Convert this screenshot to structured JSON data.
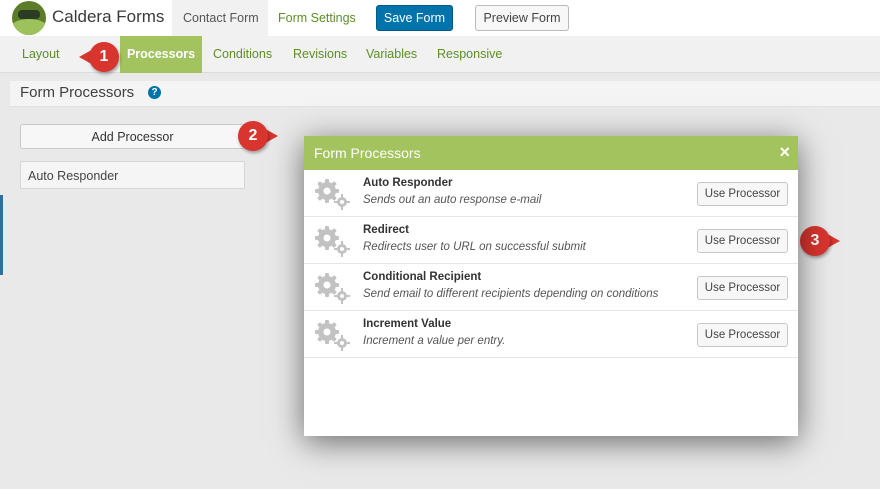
{
  "header": {
    "brand": "Caldera Forms",
    "tabs": [
      "Contact Form",
      "Form Settings"
    ],
    "save_label": "Save Form",
    "preview_label": "Preview Form"
  },
  "subnav": {
    "items": [
      "Layout",
      "Processors",
      "Conditions",
      "Revisions",
      "Variables",
      "Responsive"
    ]
  },
  "panel": {
    "title": "Form Processors",
    "help": "?",
    "add_label": "Add Processor",
    "processors": [
      "Auto Responder"
    ]
  },
  "callouts": [
    "1",
    "2",
    "3"
  ],
  "modal": {
    "title": "Form Processors",
    "close": "×",
    "button_label": "Use Processor",
    "rows": [
      {
        "title": "Auto Responder",
        "desc": "Sends out an auto response e-mail"
      },
      {
        "title": "Redirect",
        "desc": "Redirects user to URL on successful submit"
      },
      {
        "title": "Conditional Recipient",
        "desc": "Send email to different recipients depending on conditions"
      },
      {
        "title": "Increment Value",
        "desc": "Increment a value per entry."
      }
    ]
  },
  "colors": {
    "brand_green": "#a3c35f",
    "link_green": "#5b8f24",
    "primary_blue": "#0073aa",
    "callout_red": "#d8352e"
  },
  "icons": [
    "logo-icon",
    "help-icon",
    "close-icon",
    "gears-icon"
  ]
}
